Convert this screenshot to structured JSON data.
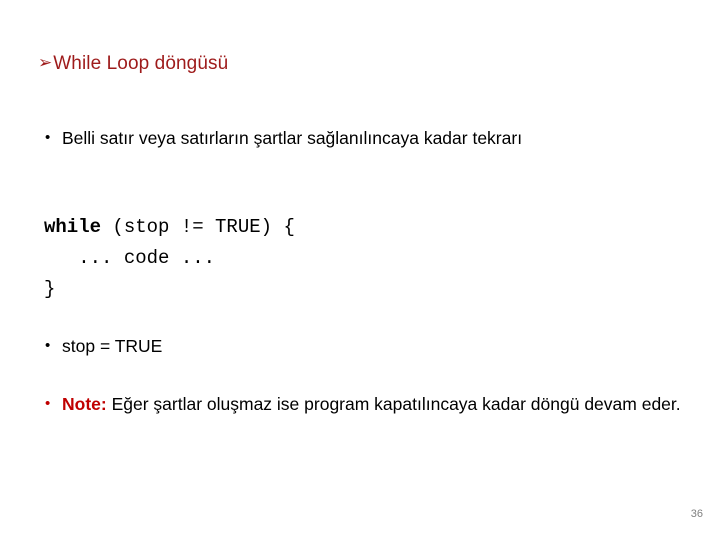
{
  "slide": {
    "title": {
      "arrow_icon": "arrow-bullet-icon",
      "arrow_glyph": "➢",
      "text": "While Loop döngüsü",
      "color": "#9E1B1B"
    },
    "bullets": [
      {
        "marker": "•",
        "text": "Belli satır veya satırların şartlar sağlanılıncaya kadar tekrarı"
      },
      {
        "marker": "•",
        "text": "stop = TRUE"
      },
      {
        "marker": "•",
        "label": "Note:",
        "label_color": "#C00000",
        "text": " Eğer şartlar oluşmaz ise program kapatılıncaya kadar döngü devam eder."
      }
    ],
    "code": {
      "keyword": "while",
      "rest_line1": " (stop != TRUE) {",
      "line2": "   ... code ...",
      "line3": "}"
    },
    "page_number": "36"
  }
}
